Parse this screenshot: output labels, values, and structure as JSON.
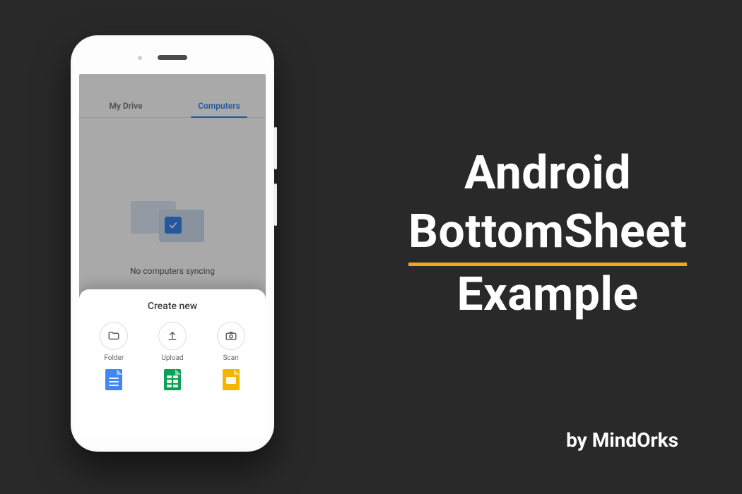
{
  "heading": {
    "line1": "Android",
    "line2": "BottomSheet",
    "line3": "Example"
  },
  "byline": "by MindOrks",
  "drive": {
    "tabs": [
      {
        "label": "My Drive",
        "active": false
      },
      {
        "label": "Computers",
        "active": true
      }
    ],
    "empty_caption": "No computers syncing"
  },
  "bottom_sheet": {
    "title": "Create new",
    "rows": [
      [
        {
          "icon": "folder",
          "label": "Folder"
        },
        {
          "icon": "upload",
          "label": "Upload"
        },
        {
          "icon": "camera",
          "label": "Scan"
        }
      ],
      [
        {
          "icon": "docs",
          "label": "Google Docs"
        },
        {
          "icon": "sheets",
          "label": "Google Sheets"
        },
        {
          "icon": "slides",
          "label": "Google Slides"
        }
      ]
    ]
  },
  "colors": {
    "background": "#292929",
    "accent": "#f0a817",
    "google_blue": "#1a73e8",
    "text_white": "#ffffff"
  }
}
